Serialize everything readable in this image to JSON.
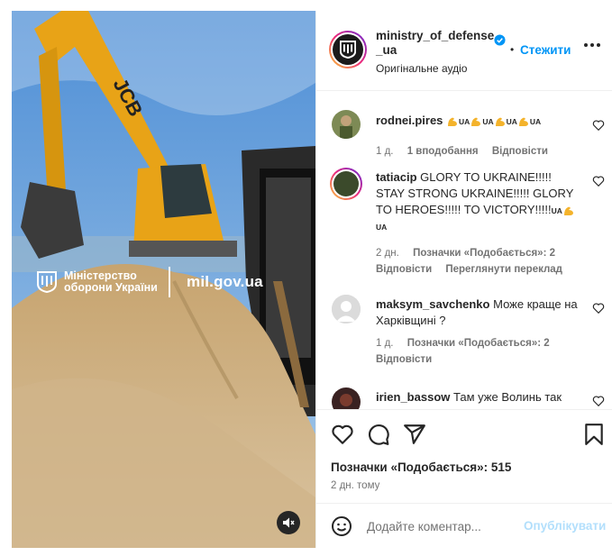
{
  "media": {
    "watermark_org": "Міністерство оборони України",
    "watermark_url": "mil.gov.ua",
    "excavator_brand": "JCB",
    "mute_icon": "speaker-muted-icon"
  },
  "header": {
    "username": "ministry_of_defense_ua",
    "separator": "•",
    "follow_label": "Стежити",
    "audio_label": "Оригінальне аудіо",
    "more_icon": "more-horizontal-icon"
  },
  "comments": [
    {
      "username": "rodnei.pires",
      "text_parts": [
        "UA",
        "UA",
        "UA",
        "UA"
      ],
      "time": "1 д.",
      "likes": "1 вподобання",
      "reply": "Відповісти"
    },
    {
      "username": "tatiacip",
      "text": "GLORY TO UKRAINE!!!!! STAY STRONG UKRAINE!!!!! GLORY TO HEROES!!!!! TO VICTORY!!!!!",
      "text_suffix": "UA",
      "text_end": "UA",
      "time": "2 дн.",
      "likes": "Позначки «Подобається»: 2",
      "reply": "Відповісти",
      "translate": "Переглянути переклад"
    },
    {
      "username": "maksym_savchenko",
      "text": "Може краще на Харківщині ?",
      "time": "1 д.",
      "likes": "Позначки «Подобається»: 2",
      "reply": "Відповісти"
    },
    {
      "username": "irien_bassow",
      "text": "Там уже Волинь так"
    }
  ],
  "actions": {
    "like_icon": "heart-icon",
    "comment_icon": "comment-icon",
    "share_icon": "send-icon",
    "save_icon": "bookmark-icon",
    "likes_text": "Позначки «Подобається»: 515",
    "timestamp": "2 дн. тому"
  },
  "compose": {
    "emoji_icon": "emoji-icon",
    "placeholder": "Додайте коментар...",
    "post_label": "Опублікувати"
  },
  "colors": {
    "accent": "#0095f6",
    "post_disabled": "#b2dffc",
    "text": "#262626",
    "muted": "#737373"
  }
}
